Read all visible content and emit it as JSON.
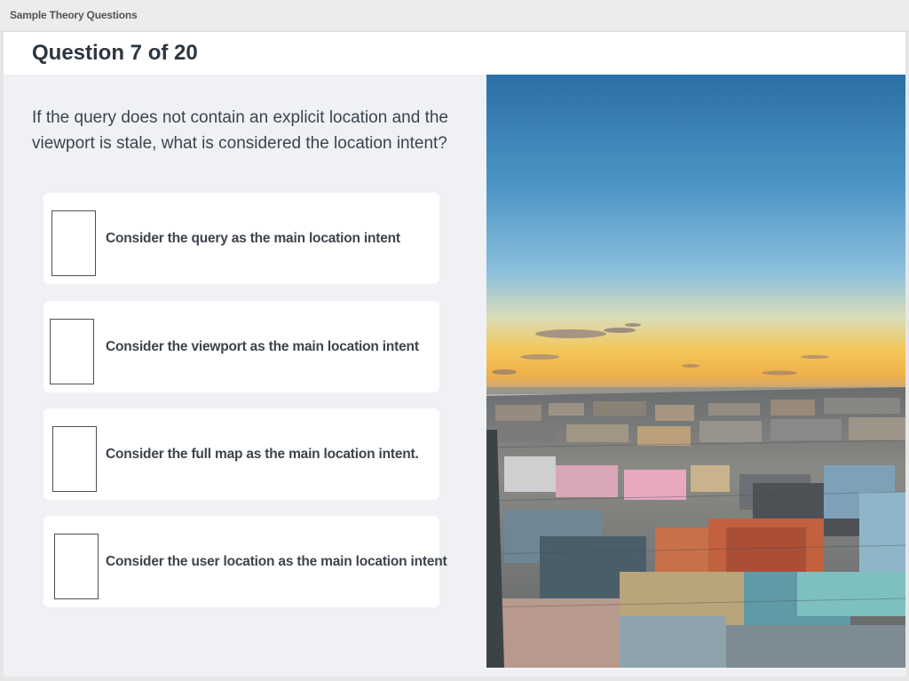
{
  "window": {
    "title": "Sample Theory Questions"
  },
  "header": {
    "question_counter": "Question 7 of 20"
  },
  "question": {
    "text": "If the query does not contain an explicit location and the viewport is stale, what is considered the location intent?"
  },
  "options": [
    {
      "label": "Consider the query as the main location intent",
      "checked": false
    },
    {
      "label": "Consider the viewport as the main location intent",
      "checked": false
    },
    {
      "label": "Consider the full map as the main location intent.",
      "checked": false
    },
    {
      "label": "Consider the user location as the main location intent",
      "checked": false
    }
  ],
  "colors": {
    "background": "#eff1f4",
    "card": "#ffffff",
    "text": "#2c3640"
  },
  "image": {
    "subject": "aerial-city-sunset-photo"
  }
}
